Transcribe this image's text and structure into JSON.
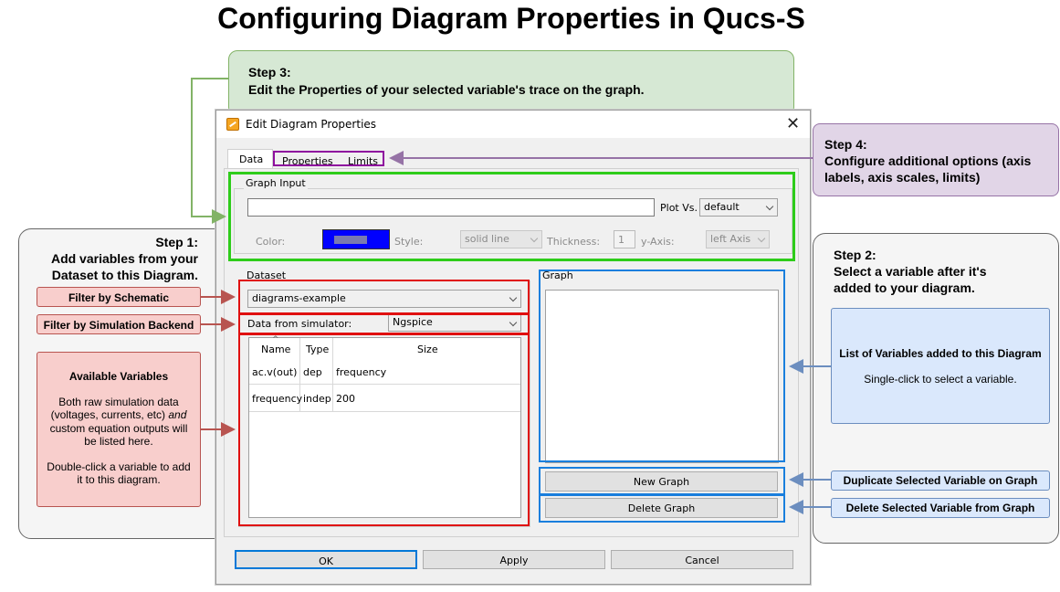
{
  "title": "Configuring Diagram Properties in Qucs-S",
  "step3": {
    "heading": "Step 3:",
    "text": "Edit the Properties of your selected variable's trace on the graph."
  },
  "step4": {
    "heading": "Step 4:",
    "text": "Configure additional options (axis labels, axis scales, limits)"
  },
  "step1": {
    "heading": "Step 1:",
    "text": "Add variables from your Dataset to this Diagram."
  },
  "step2": {
    "heading": "Step 2:",
    "text": "Select a variable after it's added to your diagram."
  },
  "left_labels": {
    "filter_schematic": "Filter by Schematic",
    "filter_backend": "Filter by Simulation Backend",
    "available_title": "Available Variables",
    "available_p1_a": "Both raw simulation data (voltages, currents, etc) ",
    "available_p1_em": "and",
    "available_p1_b": " custom equation outputs will be listed here.",
    "available_p2": "Double-click a variable to add it to this diagram."
  },
  "right_labels": {
    "list_title": "List of Variables added to this Diagram",
    "list_text": "Single-click to select a variable.",
    "duplicate": "Duplicate Selected Variable on Graph",
    "delete": "Delete Selected Variable from Graph"
  },
  "dialog": {
    "title": "Edit Diagram Properties",
    "close": "✕",
    "tabs": [
      "Data",
      "Properties",
      "Limits"
    ],
    "graph_input": {
      "label": "Graph Input",
      "input_value": "",
      "plot_vs_label": "Plot Vs.",
      "plot_vs_value": "default",
      "color_label": "Color:",
      "color_value": "#0000ff",
      "style_label": "Style:",
      "style_value": "solid line",
      "thickness_label": "Thickness:",
      "thickness_value": "1",
      "yaxis_label": "y-Axis:",
      "yaxis_value": "left Axis"
    },
    "dataset": {
      "label": "Dataset",
      "selected": "diagrams-example",
      "simulator_label": "Data from simulator:",
      "simulator_value": "Ngspice",
      "sort_indicator": "^",
      "columns": [
        "Name",
        "Type",
        "Size"
      ],
      "rows": [
        [
          "ac.v(out)",
          "dep",
          "frequency"
        ],
        [
          "frequency",
          "indep",
          "200"
        ]
      ]
    },
    "graph": {
      "label": "Graph",
      "new_button": "New Graph",
      "delete_button": "Delete Graph"
    },
    "buttons": {
      "ok": "OK",
      "apply": "Apply",
      "cancel": "Cancel"
    }
  },
  "colors": {
    "green_highlight": "#2ecc1a",
    "red_highlight": "#e01010",
    "blue_highlight": "#1a7fdd",
    "purple_highlight": "#8e0e9e",
    "arrow_green": "#82b366",
    "arrow_red": "#b85450",
    "arrow_blue": "#6c8ebf",
    "arrow_purple": "#9673a6"
  }
}
